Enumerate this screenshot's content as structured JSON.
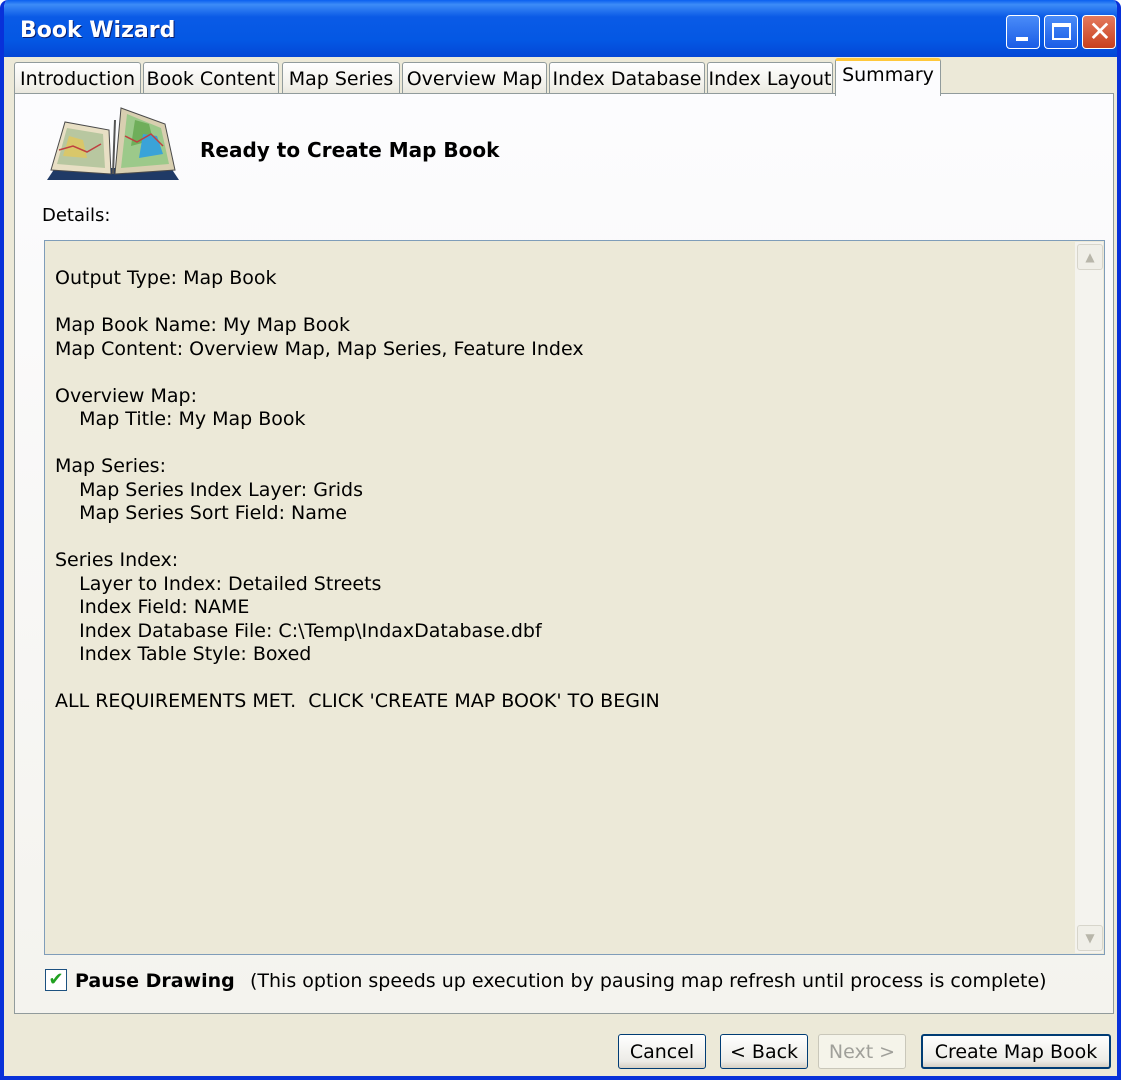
{
  "window": {
    "title": "Book Wizard",
    "close_glyph": "✕"
  },
  "tabs": [
    {
      "label": "Introduction"
    },
    {
      "label": "Book Content"
    },
    {
      "label": "Map Series"
    },
    {
      "label": "Overview Map"
    },
    {
      "label": "Index Database"
    },
    {
      "label": "Index Layout"
    },
    {
      "label": "Summary",
      "active": true
    }
  ],
  "summary": {
    "heading": "Ready to Create Map Book",
    "details_label": "Details:",
    "lines": [
      "Output Type: Map Book",
      "",
      "Map Book Name: My Map Book",
      "Map Content: Overview Map, Map Series, Feature Index",
      "",
      "Overview Map:",
      "    Map Title: My Map Book",
      "",
      "Map Series:",
      "    Map Series Index Layer: Grids",
      "    Map Series Sort Field: Name",
      "",
      "Series Index:",
      "    Layer to Index: Detailed Streets",
      "    Index Field: NAME",
      "    Index Database File: C:\\Temp\\IndaxDatabase.dbf",
      "    Index Table Style: Boxed",
      "",
      "ALL REQUIREMENTS MET.  CLICK 'CREATE MAP BOOK' TO BEGIN"
    ]
  },
  "pause_drawing": {
    "label": "Pause Drawing",
    "checked": true,
    "check_glyph": "✔",
    "note": "(This option speeds up execution by pausing map refresh until process is complete)"
  },
  "buttons": {
    "cancel": "Cancel",
    "back": "< Back",
    "next": "Next >",
    "create": "Create Map Book"
  },
  "icons": {
    "book": "map-book-icon",
    "scroll_up": "▲",
    "scroll_down": "▼"
  },
  "colors": {
    "titlebar": "#0458e4",
    "dialog_bg": "#ece9d8",
    "tab_highlight": "#ffc83c"
  }
}
